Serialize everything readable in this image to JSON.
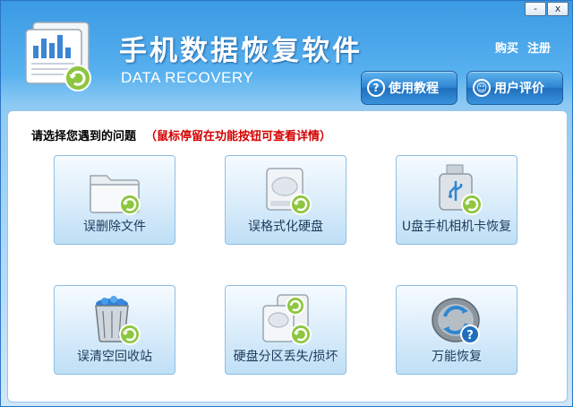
{
  "window": {
    "title": "手机数据恢复软件",
    "subtitle": "DATA RECOVERY",
    "minimize_label": "-",
    "close_label": "x"
  },
  "header": {
    "links": [
      "购买",
      "注册"
    ],
    "buttons": [
      {
        "label": "使用教程",
        "icon": "question-circle-icon"
      },
      {
        "label": "用户评价",
        "icon": "chat-circle-icon"
      }
    ]
  },
  "main": {
    "prompt": "请选择您遇到的问题",
    "hint": "（鼠标停留在功能按钮可查看详情）",
    "tiles": [
      {
        "label": "误删除文件",
        "icon": "folder-recover-icon"
      },
      {
        "label": "误格式化硬盘",
        "icon": "harddisk-recover-icon"
      },
      {
        "label": "U盘手机相机卡恢复",
        "icon": "usb-recover-icon"
      },
      {
        "label": "误清空回收站",
        "icon": "recycle-bin-recover-icon"
      },
      {
        "label": "硬盘分区丢失/损坏",
        "icon": "disk-partition-recover-icon"
      },
      {
        "label": "万能恢复",
        "icon": "universal-recover-icon"
      }
    ]
  },
  "colors": {
    "accent": "#2f86d2",
    "hint": "#d40000",
    "recover_badge": "#8dc63f"
  }
}
